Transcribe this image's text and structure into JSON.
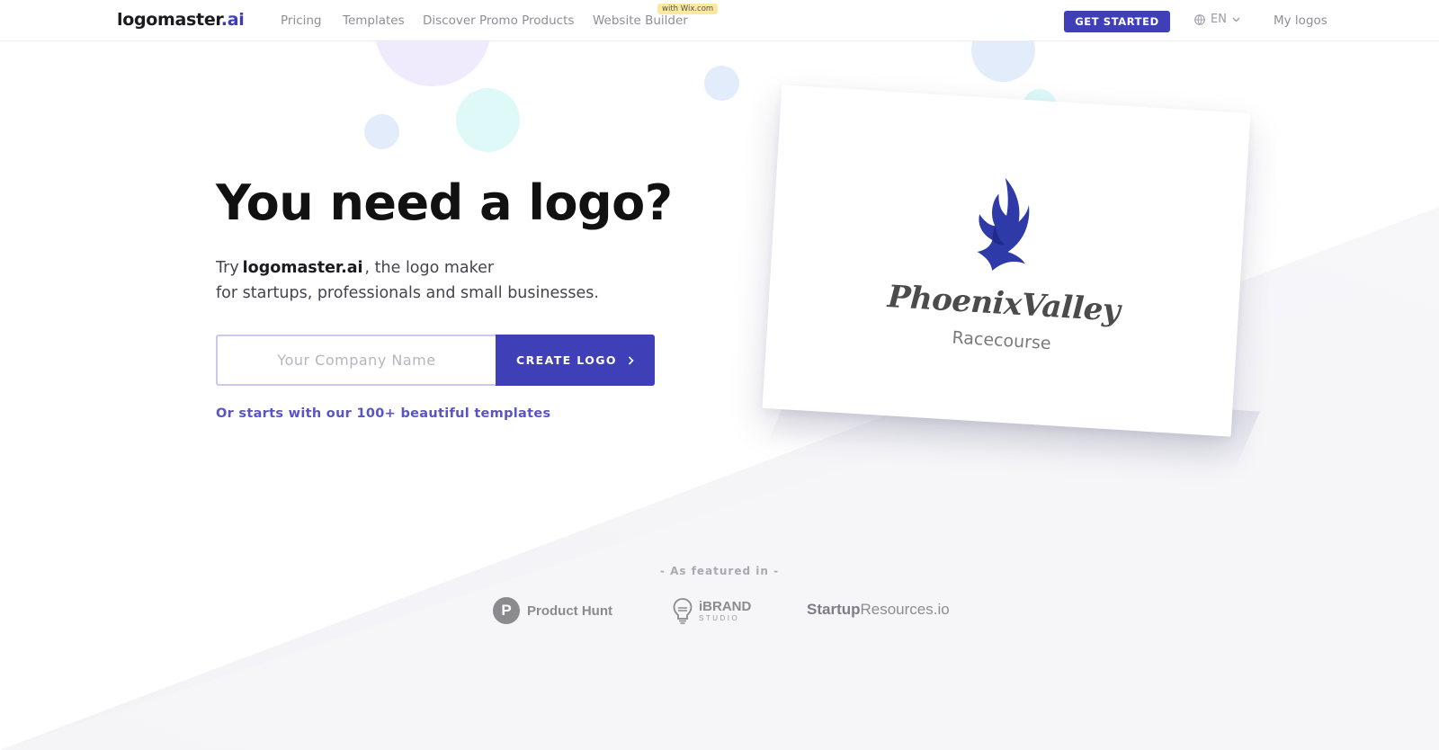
{
  "header": {
    "brand_name": "logomaster",
    "brand_tld": ".ai",
    "nav": [
      {
        "label": "Pricing"
      },
      {
        "label": "Templates"
      },
      {
        "label": "Discover Promo Products"
      },
      {
        "label": "Website Builder"
      }
    ],
    "website_builder_badge": "with Wix.com",
    "get_started_label": "GET STARTED",
    "language": "EN",
    "my_logos_label": "My logos"
  },
  "hero": {
    "title": "You need a logo?",
    "subtitle_prefix": "Try",
    "subtitle_brand": "logomaster.ai",
    "subtitle_suffix": ", the logo maker",
    "subtitle_line2": "for startups, professionals and small businesses.",
    "input_placeholder": "Your Company Name",
    "input_value": "",
    "create_button_label": "CREATE LOGO",
    "templates_link": "Or starts with our 100+ beautiful templates"
  },
  "sample_logo": {
    "name": "PhoenixValley",
    "tagline": "Racecourse",
    "icon": "phoenix-icon",
    "color": "#2e3aa8"
  },
  "featured": {
    "label": "- As featured in -",
    "logos": [
      {
        "mark": "P",
        "name": "Product Hunt"
      },
      {
        "name": "iBRAND",
        "sub": "STUDIO"
      },
      {
        "bold": "Startup",
        "rest": "Resources.io"
      }
    ]
  },
  "colors": {
    "accent": "#3f40b8",
    "link": "#5a55c4",
    "wix_badge": "#fbe9a0"
  }
}
